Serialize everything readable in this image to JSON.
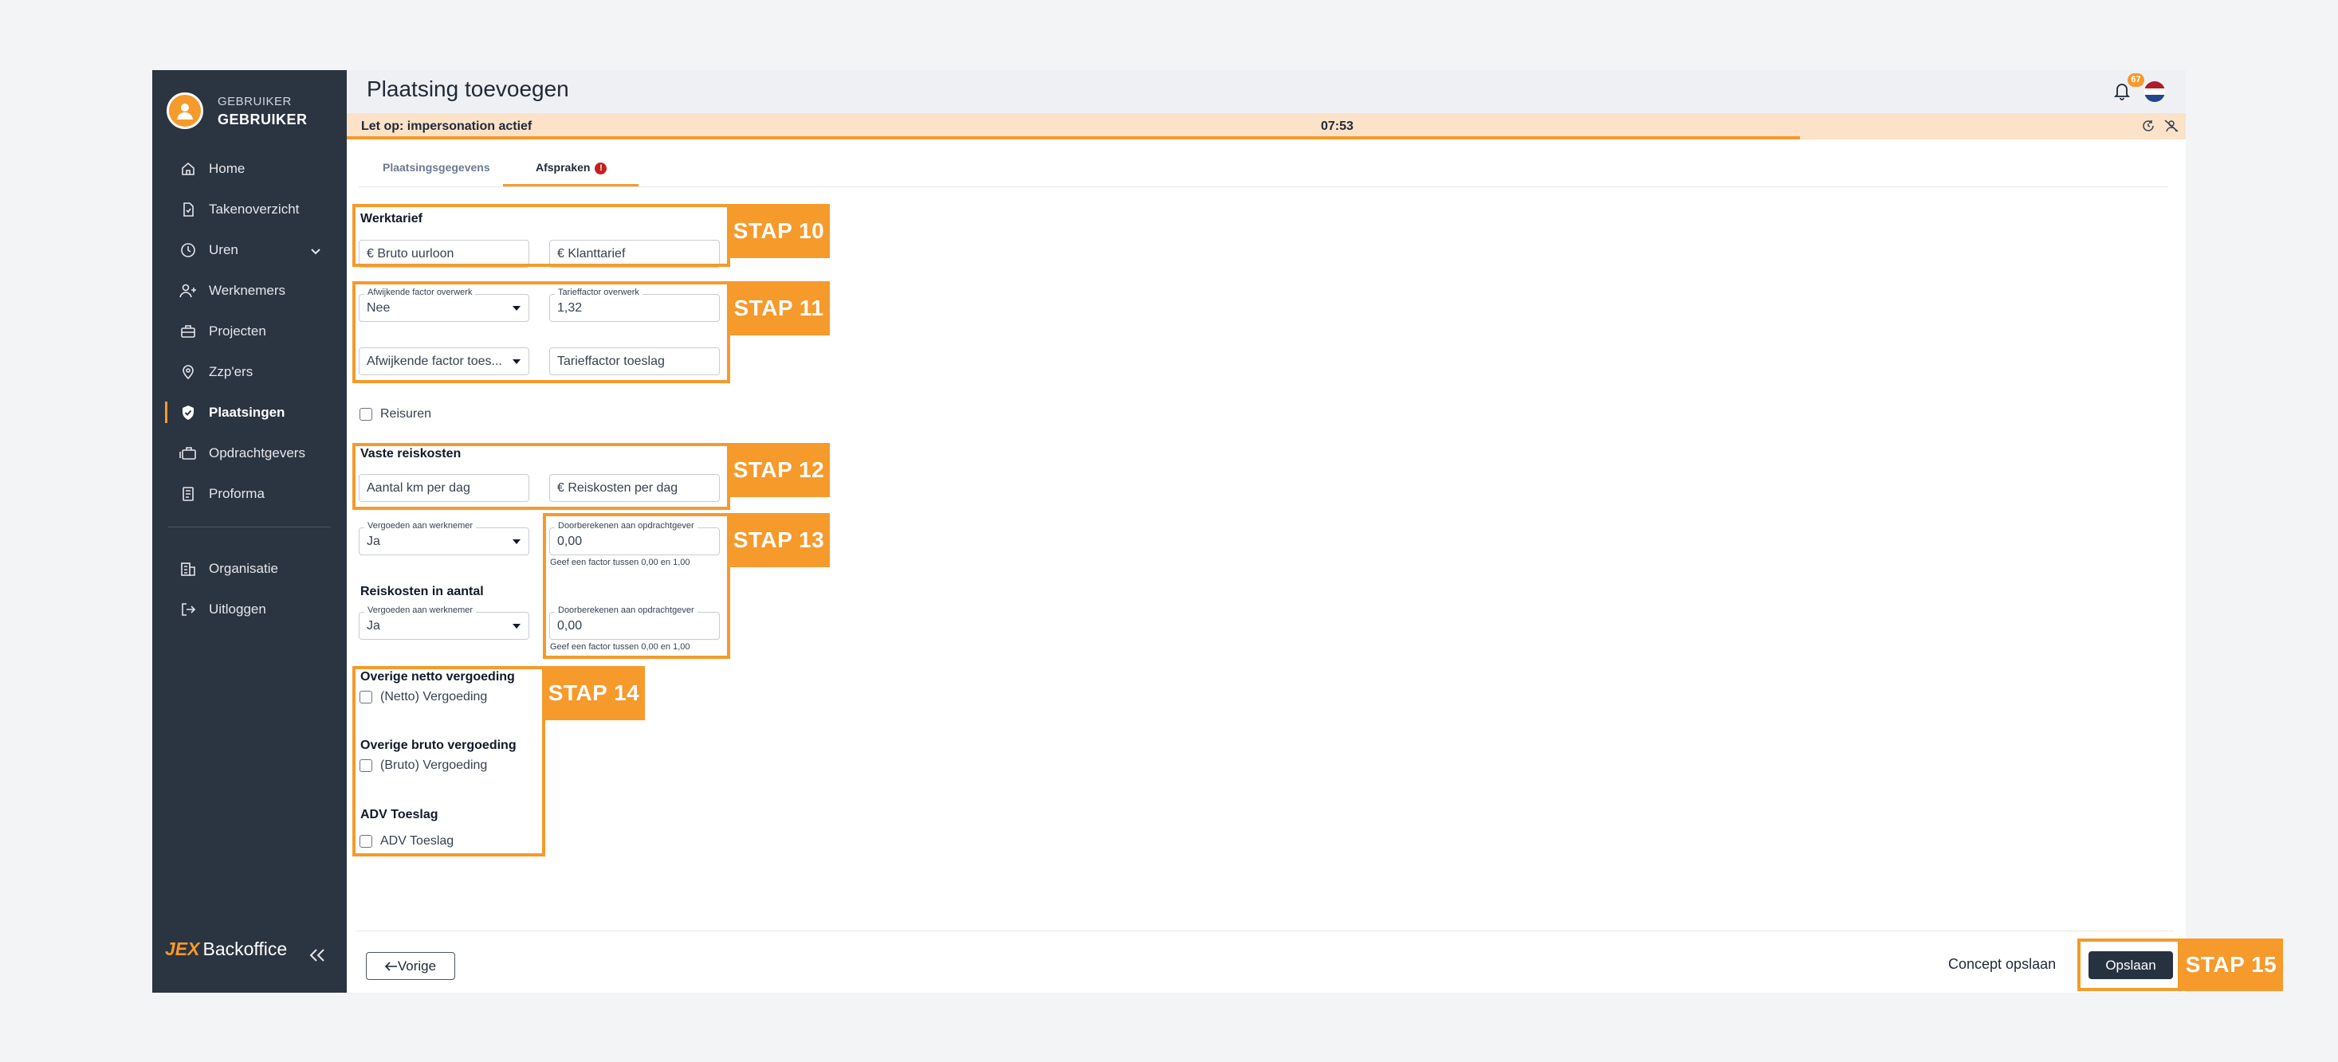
{
  "user": {
    "line1": "GEBRUIKER",
    "line2": "GEBRUIKER"
  },
  "sidebar": {
    "items": [
      {
        "label": "Home",
        "icon": "home-icon"
      },
      {
        "label": "Takenoverzicht",
        "icon": "task-list-icon"
      },
      {
        "label": "Uren",
        "icon": "clock-icon"
      },
      {
        "label": "Werknemers",
        "icon": "users-icon"
      },
      {
        "label": "Projecten",
        "icon": "briefcase-icon"
      },
      {
        "label": "Zzp'ers",
        "icon": "location-user-icon"
      },
      {
        "label": "Plaatsingen",
        "icon": "shield-check-icon"
      },
      {
        "label": "Opdrachtgevers",
        "icon": "suitcase-icon"
      },
      {
        "label": "Proforma",
        "icon": "document-icon"
      }
    ],
    "secondary": [
      {
        "label": "Organisatie",
        "icon": "building-icon"
      },
      {
        "label": "Uitloggen",
        "icon": "logout-icon"
      }
    ],
    "brand_jex": "JEX",
    "brand_name": "Backoffice"
  },
  "header": {
    "title": "Plaatsing toevoegen",
    "notification_count": "67"
  },
  "impersonation": {
    "label": "Let op: impersonation actief",
    "timer": "07:53",
    "progress": 0.79
  },
  "tabs": [
    {
      "label": "Plaatsingsgegevens"
    },
    {
      "label": "Afspraken",
      "badge": "!"
    }
  ],
  "form": {
    "werktarief": {
      "title": "Werktarief",
      "bruto_placeholder": "€ Bruto uurloon",
      "klant_placeholder": "€ Klanttarief"
    },
    "overwerk": {
      "afwijkend_label": "Afwijkende factor overwerk",
      "afwijkend_value": "Nee",
      "tarieffactor_label": "Tarieffactor overwerk",
      "tarieffactor_value": "1,32",
      "toeslag_placeholder": "Afwijkende factor toes...",
      "tarieffactor_toeslag_placeholder": "Tarieffactor toeslag"
    },
    "reisuren_label": "Reisuren",
    "vaste_reiskosten": {
      "title": "Vaste reiskosten",
      "km_placeholder": "Aantal km per dag",
      "kosten_placeholder": "€ Reiskosten per dag",
      "vergoeden_label": "Vergoeden aan werknemer",
      "vergoeden_value": "Ja",
      "doorberekenen_label": "Doorberekenen aan opdrachtgever",
      "doorberekenen_value": "0,00",
      "hint": "Geef een factor tussen 0,00 en 1,00"
    },
    "reiskosten_aantal": {
      "title": "Reiskosten in aantal",
      "vergoeden_label": "Vergoeden aan werknemer",
      "vergoeden_value": "Ja",
      "doorberekenen_label": "Doorberekenen aan opdrachtgever",
      "doorberekenen_value": "0,00",
      "hint": "Geef een factor tussen 0,00 en 1,00"
    },
    "netto": {
      "title": "Overige netto vergoeding",
      "checkbox": "(Netto) Vergoeding"
    },
    "bruto": {
      "title": "Overige bruto vergoeding",
      "checkbox": "(Bruto) Vergoeding"
    },
    "adv": {
      "title": "ADV Toeslag",
      "checkbox": "ADV Toeslag"
    }
  },
  "steps": [
    "STAP 10",
    "STAP 11",
    "STAP 12",
    "STAP 13",
    "STAP 14",
    "STAP 15"
  ],
  "footer": {
    "prev": "Vorige",
    "concept": "Concept opslaan",
    "save": "Opslaan"
  },
  "colors": {
    "accent": "#f59a2b",
    "sidebar": "#2b3441",
    "primary_button": "#273241"
  }
}
